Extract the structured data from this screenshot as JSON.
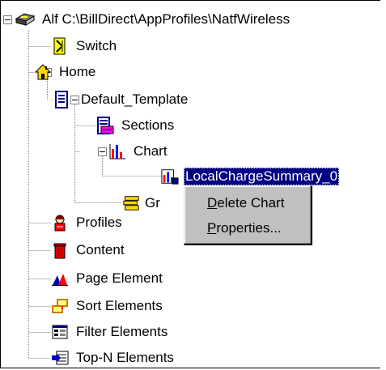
{
  "tree": {
    "root": {
      "label": "Alf C:\\BillDirect\\AppProfiles\\NatfWireless",
      "icon": "database-icon"
    },
    "switch": {
      "label": "Switch",
      "icon": "switch-icon"
    },
    "home": {
      "label": "Home",
      "icon": "house-icon"
    },
    "default_template": {
      "label": "Default_Template",
      "icon": "document-icon"
    },
    "sections": {
      "label": "Sections",
      "icon": "sections-icon"
    },
    "chart": {
      "label": "Chart",
      "icon": "chart-icon"
    },
    "local_charge_summary": {
      "label": "LocalChargeSummary_0",
      "icon": "chart-item-icon",
      "selected": true
    },
    "groups": {
      "label": "Gr",
      "icon": "stack-icon"
    },
    "profiles": {
      "label": "Profiles",
      "icon": "person-icon"
    },
    "content": {
      "label": "Content",
      "icon": "trash-icon"
    },
    "page_element": {
      "label": "Page Element",
      "icon": "page-element-icon"
    },
    "sort_elements": {
      "label": "Sort Elements",
      "icon": "sort-icon"
    },
    "filter_elements": {
      "label": "Filter Elements",
      "icon": "filter-icon"
    },
    "topn_elements": {
      "label": "Top-N Elements",
      "icon": "topn-icon"
    }
  },
  "context_menu": {
    "items": [
      {
        "label": "Delete Chart",
        "mnemonic": "D",
        "rest": "elete Chart"
      },
      {
        "label": "Properties...",
        "mnemonic": "P",
        "rest": "roperties..."
      }
    ]
  },
  "colors": {
    "selection": "#000080",
    "menu_bg": "#c0c0c0"
  }
}
